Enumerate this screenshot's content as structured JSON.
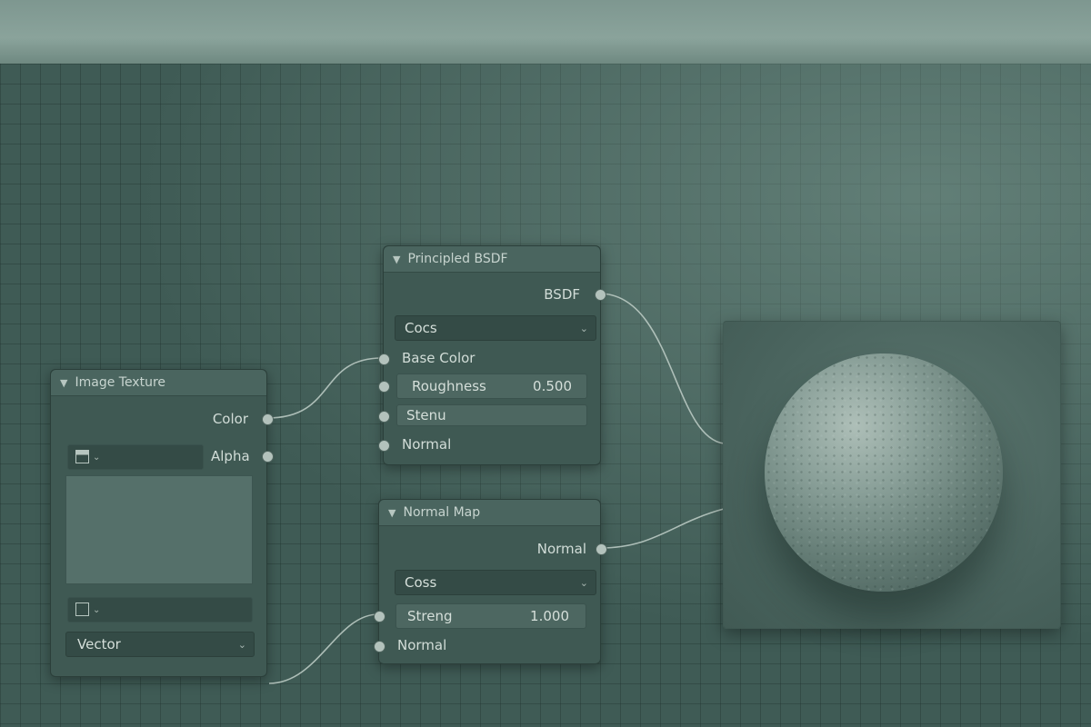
{
  "nodes": {
    "image_texture": {
      "title": "Image Texture",
      "outputs": {
        "color": "Color",
        "alpha": "Alpha"
      },
      "vector_label": "Vector"
    },
    "principled_bsdf": {
      "title": "Principled BSDF",
      "output": "BSDF",
      "dropdown": "Cocs",
      "inputs": {
        "base_color": "Base Color",
        "roughness_label": "Roughness",
        "roughness_value": "0.500",
        "stenu": "Stenu",
        "normal": "Normal"
      }
    },
    "normal_map": {
      "title": "Normal Map",
      "output": "Normal",
      "dropdown": "Coss",
      "inputs": {
        "strength_label": "Streng",
        "strength_value": "1.000",
        "normal": "Normal"
      }
    }
  },
  "icons": {
    "collapse": "chevron-down-icon",
    "image": "image-icon",
    "socket": "socket-dot-icon"
  },
  "colors": {
    "canvas": "#3f5b55",
    "node_body": "#3f5953",
    "socket": "#b3c2bc",
    "wire": "#b9c9c2"
  }
}
